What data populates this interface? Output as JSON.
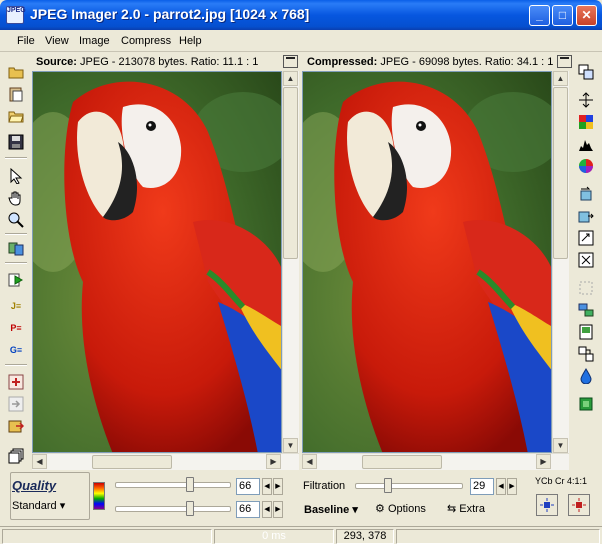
{
  "window": {
    "title": "JPEG Imager 2.0 - parrot2.jpg [1024 x 768]",
    "app_icon_text": "JPEG"
  },
  "title_buttons": {
    "minimize": "_",
    "maximize": "□",
    "close": "✕"
  },
  "menu": [
    "File",
    "View",
    "Image",
    "Compress",
    "Help"
  ],
  "source_panel": {
    "label": "Source:",
    "info": " JPEG - 213078 bytes. Ratio: 11.1 : 1"
  },
  "compressed_panel": {
    "label": "Compressed:",
    "info": " JPEG - 69098 bytes. Ratio: 34.1 : 1"
  },
  "quality": {
    "label": "Quality",
    "mode": "Standard",
    "slider1_value": "66",
    "slider2_value": "66",
    "slider1_level": 0.66,
    "slider2_level": 0.66
  },
  "filtration": {
    "label": "Filtration",
    "value": "29",
    "level": 0.29
  },
  "encoding": {
    "mode": "Baseline",
    "options_label": "Options",
    "extra_label": "Extra",
    "subsampling": "YCb Cr 4:1:1"
  },
  "status": {
    "left": "",
    "time": "0 ms",
    "coords": "293, 378",
    "right": ""
  },
  "colors": {
    "title_bar": "#0757e0",
    "close_button": "#c8422a",
    "panel_bg": "#ece9d8"
  },
  "icons": {
    "left_toolbar": [
      "open-folder-icon",
      "paste-icon",
      "browse-icon",
      "save-icon",
      "pointer-icon",
      "hand-icon",
      "zoom-icon",
      "compare-icon",
      "compress-run-icon",
      "format-jpeg-icon",
      "format-png-icon",
      "format-gif-icon",
      "add-icon",
      "next-icon",
      "export-icon",
      "cascade-icon"
    ],
    "right_toolbar": [
      "copy-panels-icon",
      "resize-icon",
      "palette-grid-icon",
      "histogram-icon",
      "color-wheel-icon",
      "rotate-icon",
      "flip-icon",
      "crop-icon",
      "transform-icon",
      "select-icon",
      "arrange-icon",
      "slideshow-icon",
      "split-icon",
      "droplet-icon",
      "green-square-icon"
    ]
  }
}
